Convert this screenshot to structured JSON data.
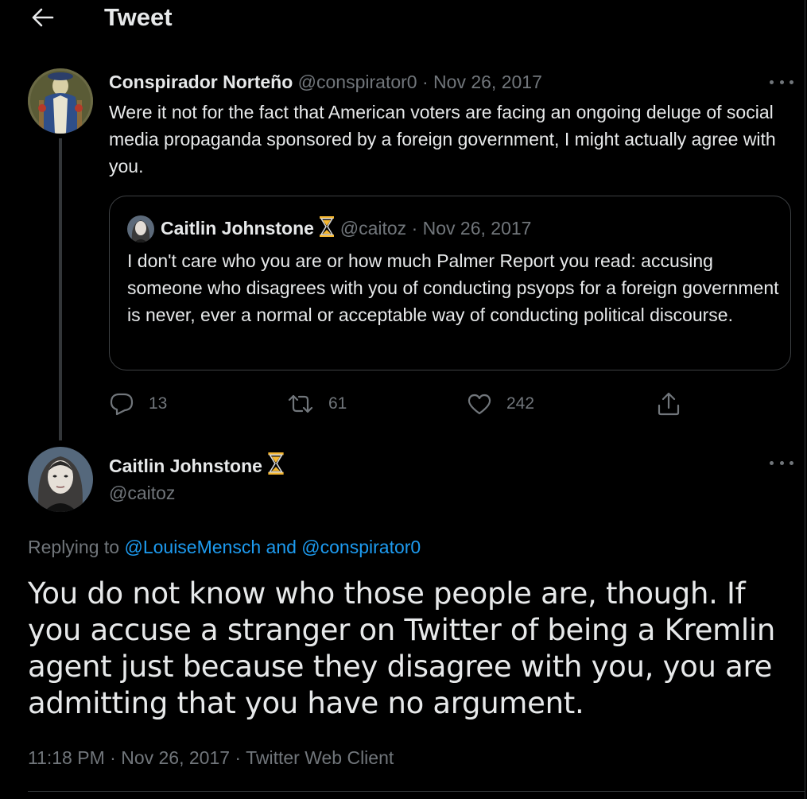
{
  "header": {
    "title": "Tweet"
  },
  "parent_tweet": {
    "author_name": "Conspirador Norteño",
    "handle": "@conspirator0",
    "separator": "·",
    "date": "Nov 26, 2017",
    "text": "Were it not for the fact that American voters are facing an ongoing deluge of social media propaganda sponsored by a foreign government, I might actually agree with you.",
    "quote": {
      "author_name": "Caitlin Johnstone",
      "handle": "@caitoz",
      "separator": "·",
      "date": "Nov 26, 2017",
      "text": "I don't care who you are or how much Palmer Report you read: accusing someone who disagrees with you of conducting psyops for a foreign government is never, ever a normal or acceptable way of conducting political discourse."
    },
    "actions": {
      "replies": "13",
      "retweets": "61",
      "likes": "242"
    }
  },
  "main_tweet": {
    "author_name": "Caitlin Johnstone",
    "handle": "@caitoz",
    "replying_prefix": "Replying to",
    "replying_user_1": "@LouiseMensch",
    "replying_and": "and",
    "replying_user_2": "@conspirator0",
    "text": "You do not know who those people are, though. If you accuse a stranger on Twitter of being a Kremlin agent just because they disagree with you, you are admitting that you have no argument.",
    "time": "11:18 PM",
    "date": "Nov 26, 2017",
    "separator": "·",
    "client": "Twitter Web Client"
  },
  "icons": {
    "back": "arrow-left-icon",
    "more": "more-horizontal-icon",
    "reply": "reply-bubble-icon",
    "retweet": "retweet-icon",
    "like": "heart-icon",
    "share": "share-icon",
    "badge": "hourglass-icon"
  },
  "colors": {
    "background": "#000000",
    "text": "#e7e9ea",
    "muted": "#71767b",
    "link": "#1d9bf0",
    "badge": "#f5b731"
  }
}
